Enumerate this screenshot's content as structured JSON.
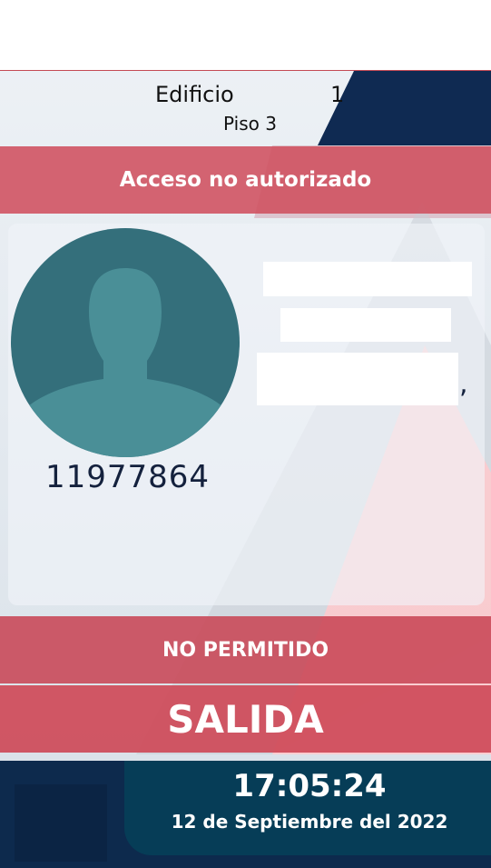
{
  "header": {
    "building_label": "Edificio",
    "building_number": "1",
    "floor": "Piso 3"
  },
  "access_banner": "Acceso no autorizado",
  "user": {
    "id": "11977864",
    "name_suffix": ","
  },
  "status": "NO PERMITIDO",
  "direction": "SALIDA",
  "clock": {
    "time": "17:05:24",
    "date": "12 de Septiembre del 2022"
  },
  "colors": {
    "banner_red": "#cf505e",
    "navy": "#0d2a4d",
    "teal_panel": "#063d57",
    "avatar_fill": "#346f7b"
  },
  "icons": {
    "avatar": "person-silhouette-icon"
  }
}
